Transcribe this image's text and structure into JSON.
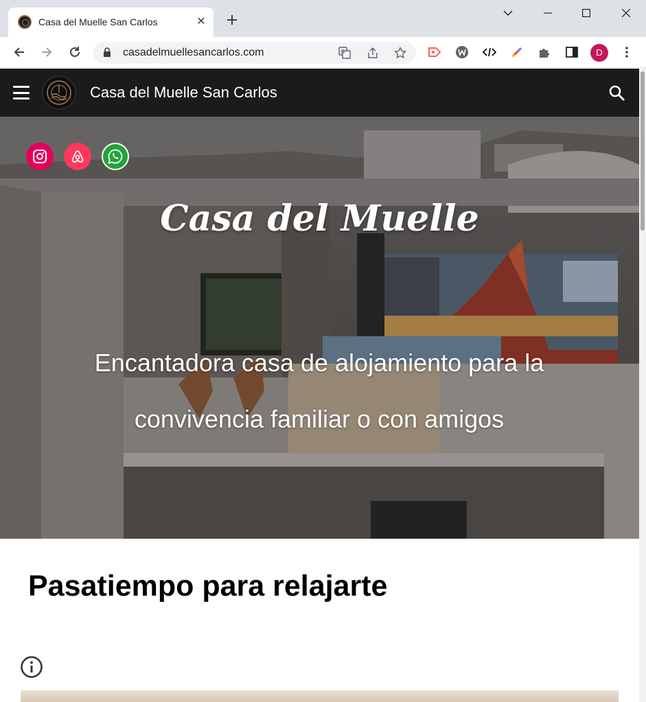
{
  "browser": {
    "tab_title": "Casa del Muelle San Carlos",
    "url": "casadelmuellesancarlos.com",
    "profile_initial": "D"
  },
  "site": {
    "title": "Casa del Muelle San Carlos",
    "social": [
      "instagram-icon",
      "airbnb-icon",
      "whatsapp-icon"
    ],
    "hero_brand": "Casa del Muelle",
    "hero_tagline": "Encantadora casa de alojamiento para la convivencia familiar o con amigos",
    "section_title": "Pasatiempo para relajarte"
  },
  "colors": {
    "header_bg": "#1b1b1b",
    "instagram": "#e6005c",
    "airbnb": "#ff385c",
    "whatsapp": "#25a33a",
    "profile": "#c2185b"
  }
}
